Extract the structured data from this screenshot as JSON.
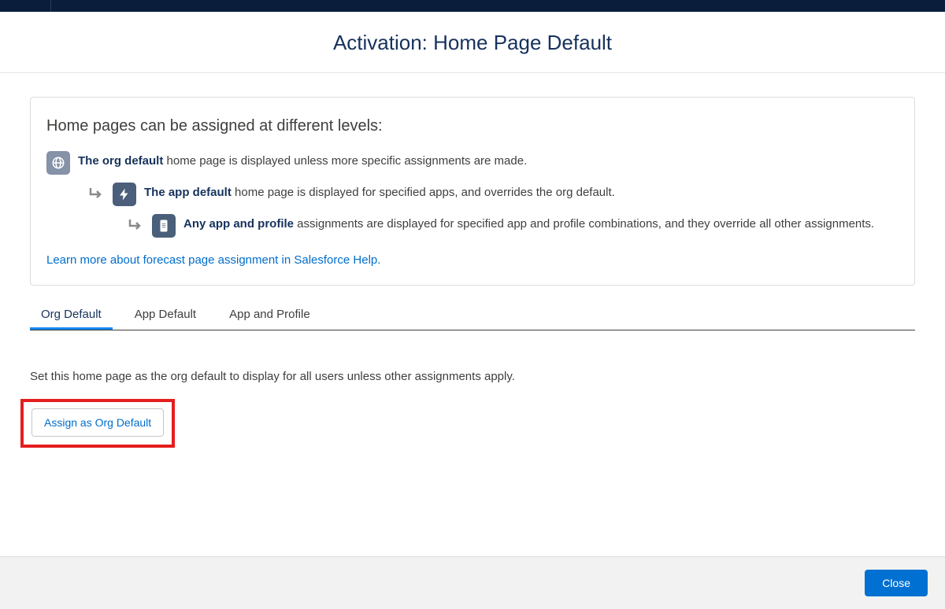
{
  "header": {
    "title": "Activation: Home Page Default"
  },
  "info": {
    "heading": "Home pages can be assigned at different levels:",
    "levels": [
      {
        "bold": "The org default",
        "rest": " home page is displayed unless more specific assignments are made."
      },
      {
        "bold": "The app default",
        "rest": " home page is displayed for specified apps, and overrides the org default."
      },
      {
        "bold": "Any app and profile",
        "rest": " assignments are displayed for specified app and profile combinations, and they override all other assignments."
      }
    ],
    "learn_link": "Learn more about forecast page assignment in Salesforce Help."
  },
  "tabs": [
    {
      "label": "Org Default",
      "active": true
    },
    {
      "label": "App Default",
      "active": false
    },
    {
      "label": "App and Profile",
      "active": false
    }
  ],
  "tab_content": {
    "description": "Set this home page as the org default to display for all users unless other assignments apply.",
    "assign_button": "Assign as Org Default"
  },
  "footer": {
    "close": "Close"
  }
}
